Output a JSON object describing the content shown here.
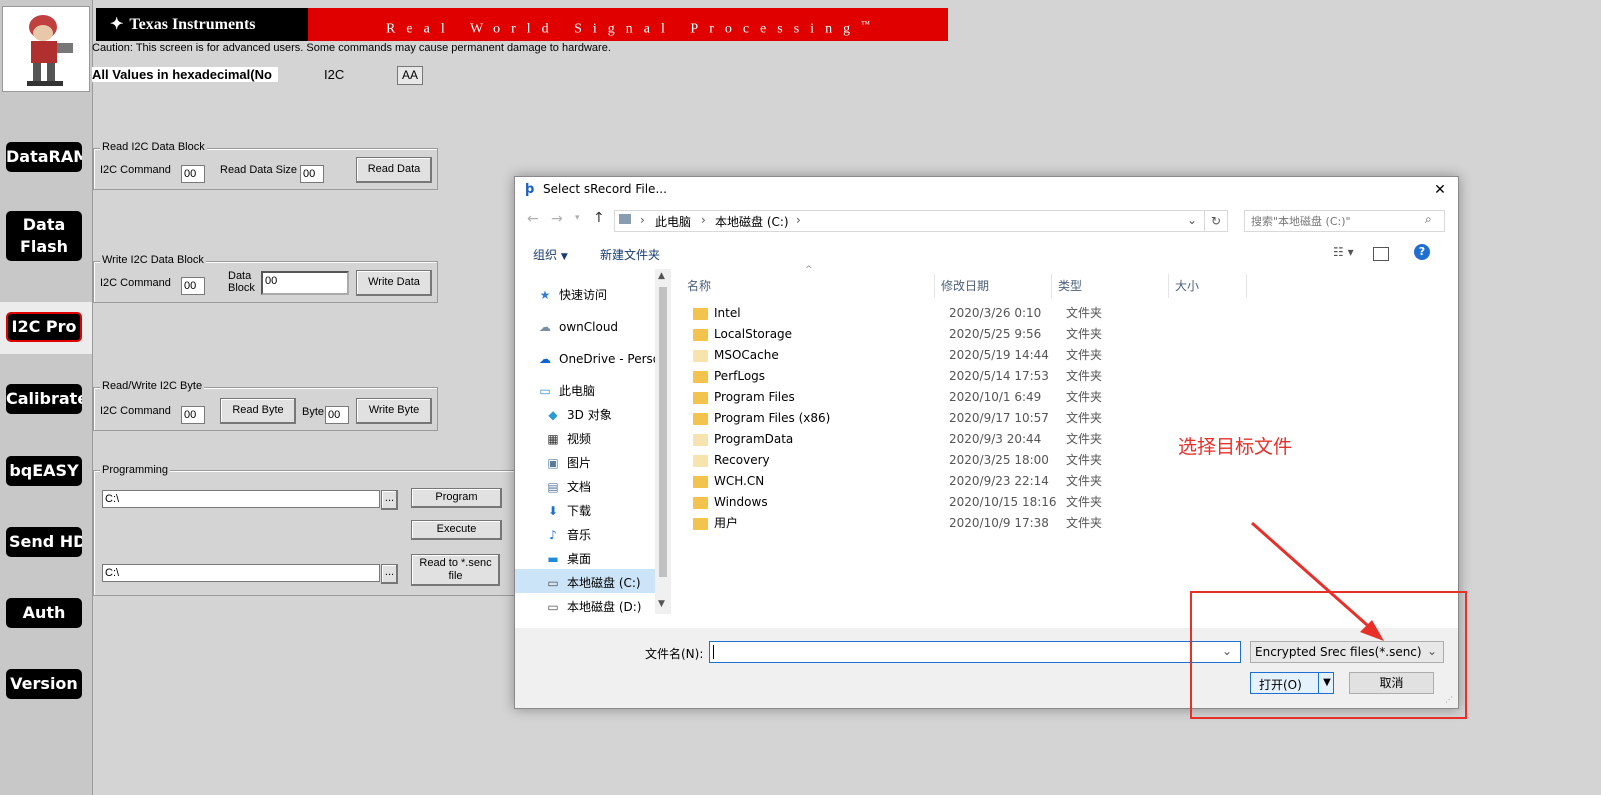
{
  "window": {
    "title_char": "Ϸ"
  },
  "header": {
    "brand": "Texas Instruments",
    "tagline": "Real World Signal Processing",
    "tm": "™"
  },
  "caution": "Caution: This screen is for advanced users. Some commands may cause permanent damage to hardware.",
  "values_label": "All Values in hexadecimal(No",
  "i2c_label": "I2C",
  "i2c_address": "AA",
  "nav": {
    "items": [
      {
        "label": "DataRAM"
      },
      {
        "label": "Data Flash"
      },
      {
        "label": "I2C Pro"
      },
      {
        "label": "Calibrate"
      },
      {
        "label": "bqEASY"
      },
      {
        "label": "Send HDQ"
      },
      {
        "label": "Auth"
      },
      {
        "label": "Version"
      }
    ],
    "data_line1": "Data",
    "data_line2": "Flash",
    "send_hdq": "Send HDQ",
    "selected": "I2C Pro"
  },
  "read_block": {
    "title": "Read I2C Data Block",
    "cmd_label": "I2C Command",
    "cmd_value": "00",
    "size_label": "Read Data Size",
    "size_value": "00",
    "button": "Read Data"
  },
  "write_block": {
    "title": "Write I2C Data Block",
    "cmd_label": "I2C Command",
    "cmd_value": "00",
    "data_label1": "Data",
    "data_label2": "Block",
    "data_value": "00",
    "button": "Write Data"
  },
  "rw_byte": {
    "title": "Read/Write I2C Byte",
    "cmd_label": "I2C Command",
    "cmd_value": "00",
    "read_button": "Read Byte",
    "byte_label": "Byte",
    "byte_value": "00",
    "write_button": "Write Byte"
  },
  "programming": {
    "title": "Programming",
    "path1": "C:\\",
    "browse1": "...",
    "program_button": "Program",
    "execute_button": "Execute",
    "path2": "C:\\",
    "browse2": "...",
    "read_senc_line1": "Read to *.senc",
    "read_senc_line2": "file"
  },
  "dialog": {
    "title": "Select sRecord File...",
    "close": "✕",
    "address": [
      "此电脑",
      "本地磁盘 (C:)"
    ],
    "search_placeholder": "搜索\"本地磁盘 (C:)\"",
    "toolbar": {
      "organize": "组织",
      "new_folder": "新建文件夹"
    },
    "columns": {
      "name": "名称",
      "date": "修改日期",
      "type": "类型",
      "size": "大小"
    },
    "nav_items": [
      {
        "label": "快速访问",
        "icon": "star-icon"
      },
      {
        "label": "ownCloud",
        "icon": "cloud-icon"
      },
      {
        "label": "OneDrive - Perso",
        "icon": "onedrive-icon"
      },
      {
        "label": "此电脑",
        "icon": "computer-icon"
      },
      {
        "label": "3D 对象",
        "icon": "cube-icon"
      },
      {
        "label": "视频",
        "icon": "video-icon"
      },
      {
        "label": "图片",
        "icon": "picture-icon"
      },
      {
        "label": "文档",
        "icon": "document-icon"
      },
      {
        "label": "下载",
        "icon": "download-icon"
      },
      {
        "label": "音乐",
        "icon": "music-icon"
      },
      {
        "label": "桌面",
        "icon": "desktop-icon"
      },
      {
        "label": "本地磁盘 (C:)",
        "icon": "drive-icon"
      },
      {
        "label": "本地磁盘 (D:)",
        "icon": "drive-icon"
      }
    ],
    "files": [
      {
        "name": "Intel",
        "date": "2020/3/26 0:10",
        "type": "文件夹"
      },
      {
        "name": "LocalStorage",
        "date": "2020/5/25 9:56",
        "type": "文件夹"
      },
      {
        "name": "MSOCache",
        "date": "2020/5/19 14:44",
        "type": "文件夹"
      },
      {
        "name": "PerfLogs",
        "date": "2020/5/14 17:53",
        "type": "文件夹"
      },
      {
        "name": "Program Files",
        "date": "2020/10/1 6:49",
        "type": "文件夹"
      },
      {
        "name": "Program Files (x86)",
        "date": "2020/9/17 10:57",
        "type": "文件夹"
      },
      {
        "name": "ProgramData",
        "date": "2020/9/3 20:44",
        "type": "文件夹"
      },
      {
        "name": "Recovery",
        "date": "2020/3/25 18:00",
        "type": "文件夹"
      },
      {
        "name": "WCH.CN",
        "date": "2020/9/23 22:14",
        "type": "文件夹"
      },
      {
        "name": "Windows",
        "date": "2020/10/15 18:16",
        "type": "文件夹"
      },
      {
        "name": "用户",
        "date": "2020/10/9 17:38",
        "type": "文件夹"
      }
    ],
    "filename_label": "文件名(N):",
    "filename_value": "",
    "filter": "Encrypted Srec files(*.senc)",
    "open_button": "打开(O)",
    "cancel_button": "取消"
  },
  "annotation": {
    "text": "选择目标文件",
    "color": "#e8302a"
  }
}
